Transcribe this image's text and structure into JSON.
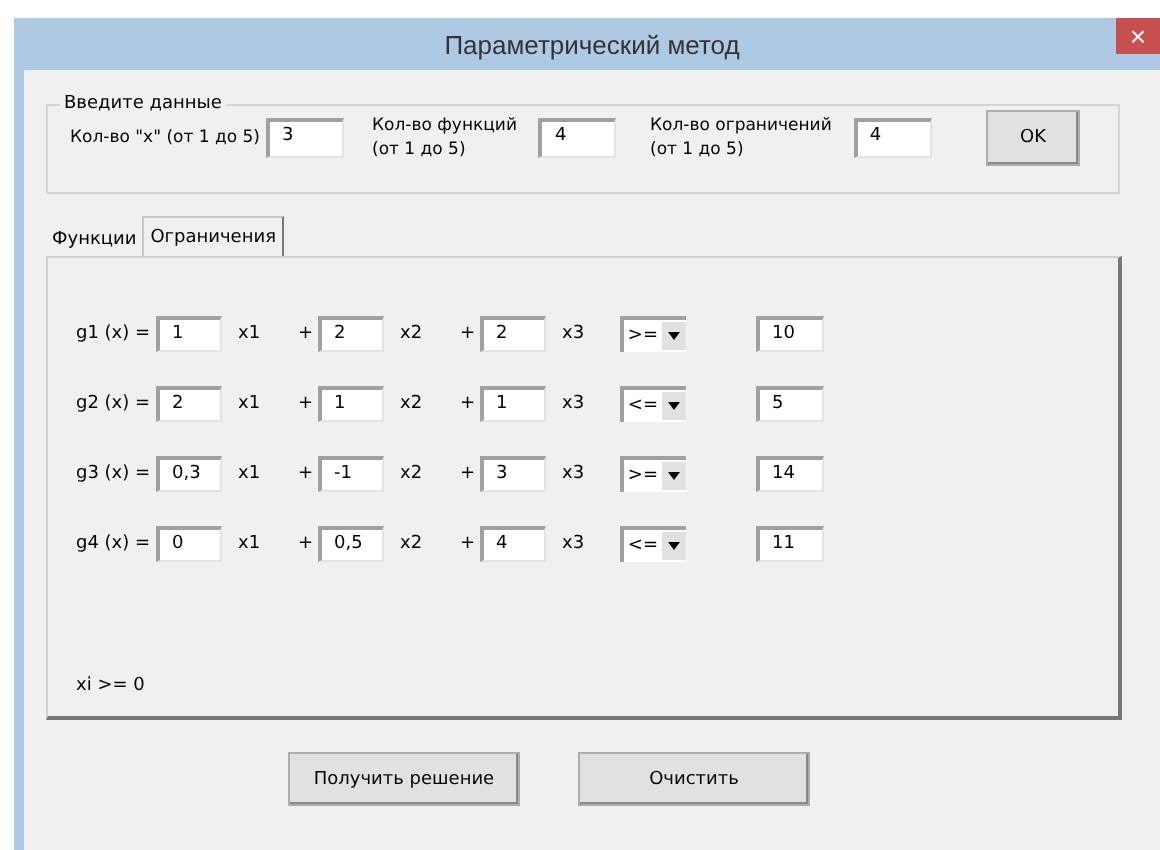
{
  "window": {
    "title": "Параметрический метод",
    "close": "×"
  },
  "input_group": {
    "legend": "Введите данные",
    "fields": [
      {
        "label": "Кол-во \"x\" (от 1 до 5)",
        "value": "3"
      },
      {
        "label": "Кол-во функций\n(от 1 до 5)",
        "value": "4"
      },
      {
        "label": "Кол-во ограничений\n(от 1 до 5)",
        "value": "4"
      }
    ],
    "ok_button": "OK"
  },
  "tabs": [
    {
      "label": "Функции",
      "selected": false
    },
    {
      "label": "Ограничения",
      "selected": true
    }
  ],
  "constraints": [
    {
      "name": "g1 (x) =",
      "terms": [
        {
          "value": "1",
          "variable": "x1"
        },
        {
          "plus": "+",
          "value": "2",
          "variable": "x2"
        },
        {
          "plus": "+",
          "value": "2",
          "variable": "x3"
        }
      ],
      "sign": ">=",
      "rhs": "10"
    },
    {
      "name": "g2 (x) =",
      "terms": [
        {
          "value": "2",
          "variable": "x1"
        },
        {
          "plus": "+",
          "value": "1",
          "variable": "x2"
        },
        {
          "plus": "+",
          "value": "1",
          "variable": "x3"
        }
      ],
      "sign": "<=",
      "rhs": "5"
    },
    {
      "name": "g3 (x) =",
      "terms": [
        {
          "value": "0,3",
          "variable": "x1"
        },
        {
          "plus": "+",
          "value": "-1",
          "variable": "x2"
        },
        {
          "plus": "+",
          "value": "3",
          "variable": "x3"
        }
      ],
      "sign": ">=",
      "rhs": "14"
    },
    {
      "name": "g4 (x) =",
      "terms": [
        {
          "value": "0",
          "variable": "x1"
        },
        {
          "plus": "+",
          "value": "0,5",
          "variable": "x2"
        },
        {
          "plus": "+",
          "value": "4",
          "variable": "x3"
        }
      ],
      "sign": "<=",
      "rhs": "11"
    }
  ],
  "note": "xi >= 0",
  "buttons": [
    "Получить решение",
    "Очистить"
  ]
}
